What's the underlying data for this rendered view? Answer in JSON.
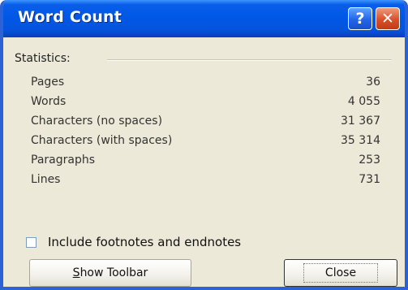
{
  "window": {
    "title": "Word Count"
  },
  "titlebar": {
    "help_glyph": "?",
    "close_glyph": "✕"
  },
  "statistics": {
    "group_label": "Statistics:",
    "rows": [
      {
        "label": "Pages",
        "value": "36"
      },
      {
        "label": "Words",
        "value": "4 055"
      },
      {
        "label": "Characters (no spaces)",
        "value": "31 367"
      },
      {
        "label": "Characters (with spaces)",
        "value": "35 314"
      },
      {
        "label": "Paragraphs",
        "value": "253"
      },
      {
        "label": "Lines",
        "value": "731"
      }
    ]
  },
  "options": {
    "footnotes_label": "Include footnotes and endnotes",
    "footnotes_checked": false
  },
  "buttons": {
    "show_toolbar_mnemonic": "S",
    "show_toolbar_rest": "how Toolbar",
    "close_label": "Close"
  }
}
